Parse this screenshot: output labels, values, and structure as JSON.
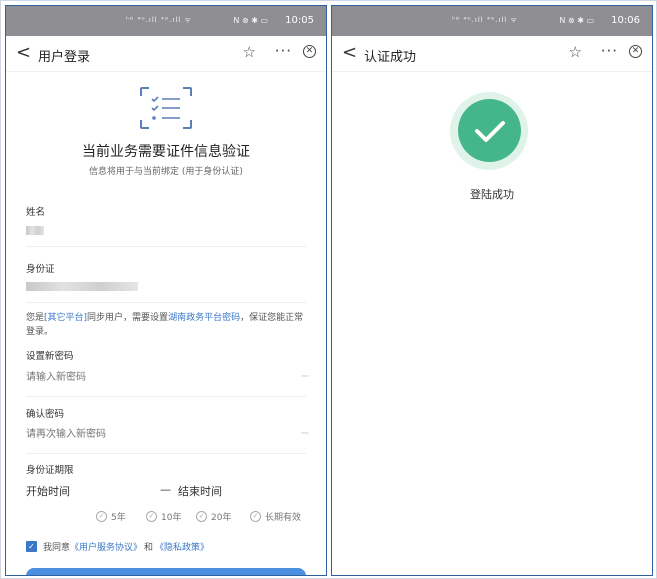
{
  "left": {
    "status": {
      "network": "ʰᴰ ⁴ᴳ.ıll ⁴ᴳ.ıll ᯤ",
      "system": "N ⊗ ✱ ▭",
      "time": "10:05"
    },
    "nav": {
      "back": "<",
      "title": "用户登录",
      "star": "☆",
      "more": "···",
      "close": "✕"
    },
    "heading": "当前业务需要证件信息验证",
    "subheading": "信息将用于与当前绑定 (用于身份认证)",
    "name_label": "姓名",
    "id_label": "身份证",
    "notice": {
      "p1": "您是",
      "link1": "[其它平台]",
      "p2": "同步用户，需要设置",
      "link2": "湖南政务平台密码",
      "p3": "，保证您能正常登录。"
    },
    "new_password": {
      "label": "设置新密码",
      "placeholder": "请输入新密码",
      "eye": "ᵕᵕᵕ"
    },
    "confirm_password": {
      "label": "确认密码",
      "placeholder": "请再次输入新密码",
      "eye": "ᵕᵕᵕ"
    },
    "validity": {
      "label": "身份证期限",
      "start": "开始时间",
      "separator": "—",
      "end": "结束时间",
      "options": [
        "5年",
        "10年",
        "20年",
        "长期有效"
      ]
    },
    "agree": {
      "check": "✓",
      "prefix": "我同意",
      "terms": "《用户服务协议》",
      "and": "和",
      "privacy": "《隐私政策》"
    }
  },
  "right": {
    "status": {
      "network": "ʰᴰ ⁴ᴳ.ıll ⁴ᴳ.ıll ᯤ",
      "system": "N ⊗ ✱ ▭",
      "time": "10:06"
    },
    "nav": {
      "back": "<",
      "title": "认证成功",
      "star": "☆",
      "more": "···",
      "close": "✕"
    },
    "success_text": "登陆成功"
  },
  "colors": {
    "accent": "#3a77c8",
    "success": "#45b68b",
    "statusbar": "#8e8e93"
  },
  "icons": [
    "back-icon",
    "star-icon",
    "more-icon",
    "close-icon",
    "document-checklist-icon",
    "eye-closed-icon",
    "check-circle-icon",
    "checkbox-icon",
    "success-check-icon"
  ]
}
